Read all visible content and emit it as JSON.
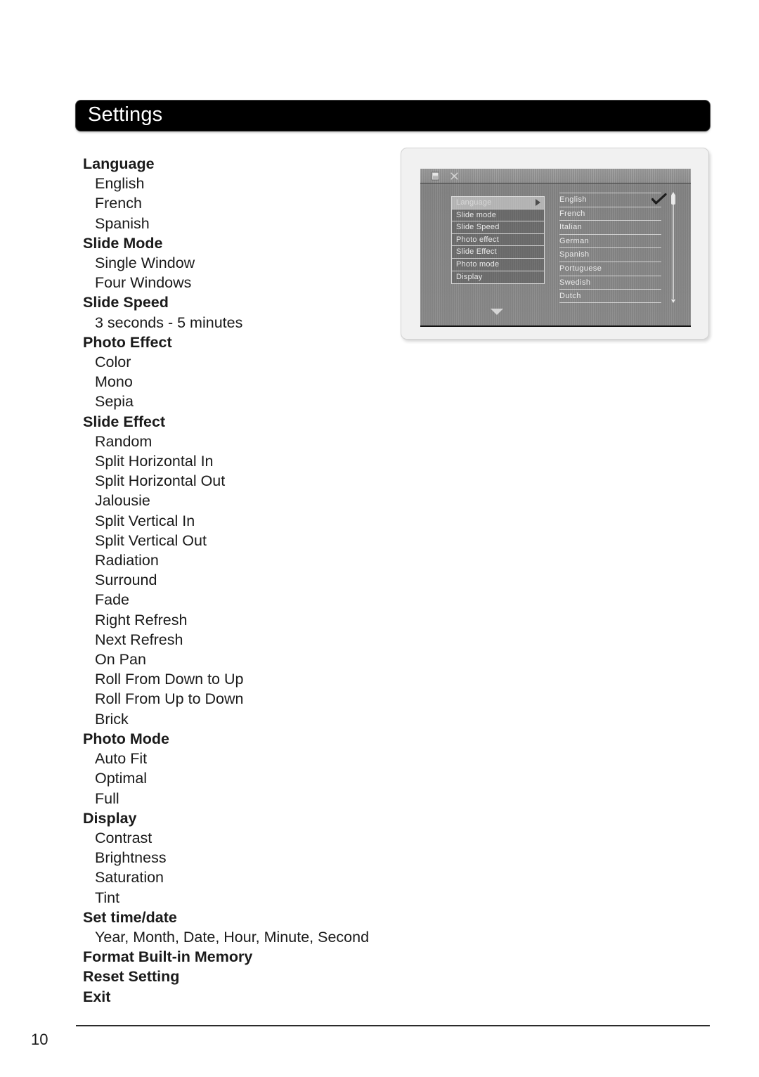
{
  "page": {
    "title": "Settings",
    "number": "10"
  },
  "settings_outline": [
    {
      "title": "Language",
      "items": [
        "English",
        "French",
        "Spanish"
      ]
    },
    {
      "title": "Slide Mode",
      "items": [
        "Single Window",
        "Four Windows"
      ]
    },
    {
      "title": "Slide Speed",
      "items": [
        "3 seconds - 5 minutes"
      ]
    },
    {
      "title": "Photo Effect",
      "items": [
        "Color",
        "Mono",
        "Sepia"
      ]
    },
    {
      "title": "Slide Effect",
      "items": [
        "Random",
        "Split Horizontal In",
        "Split Horizontal Out",
        "Jalousie",
        "Split Vertical In",
        "Split Vertical Out",
        "Radiation",
        "Surround",
        "Fade",
        "Right Refresh",
        "Next Refresh",
        "On Pan",
        "Roll From Down to Up",
        "Roll From Up to Down",
        "Brick"
      ]
    },
    {
      "title": "Photo Mode",
      "items": [
        "Auto Fit",
        "Optimal",
        "Full"
      ]
    },
    {
      "title": "Display",
      "items": [
        "Contrast",
        "Brightness",
        "Saturation",
        "Tint"
      ]
    },
    {
      "title": "Set time/date",
      "items": [
        "Year, Month, Date, Hour, Minute, Second"
      ]
    },
    {
      "title": "Format Built-in Memory",
      "items": []
    },
    {
      "title": "Reset Setting",
      "items": []
    },
    {
      "title": "Exit",
      "items": []
    }
  ],
  "device": {
    "toolbar_icons": [
      "memory-card-icon",
      "tools-icon"
    ],
    "menu": [
      {
        "label": "Language",
        "selected": true,
        "has_submenu": true
      },
      {
        "label": "Slide mode",
        "selected": false,
        "has_submenu": false
      },
      {
        "label": "Slide Speed",
        "selected": false,
        "has_submenu": false
      },
      {
        "label": "Photo effect",
        "selected": false,
        "has_submenu": false
      },
      {
        "label": "Slide Effect",
        "selected": false,
        "has_submenu": false
      },
      {
        "label": "Photo mode",
        "selected": false,
        "has_submenu": false
      },
      {
        "label": "Display",
        "selected": false,
        "has_submenu": false
      }
    ],
    "scroll_down_indicator": "chevron-down-icon",
    "options": [
      {
        "label": "English",
        "checked": true
      },
      {
        "label": "French",
        "checked": false
      },
      {
        "label": "Italian",
        "checked": false
      },
      {
        "label": "German",
        "checked": false
      },
      {
        "label": "Spanish",
        "checked": false
      },
      {
        "label": "Portuguese",
        "checked": false
      },
      {
        "label": "Swedish",
        "checked": false
      },
      {
        "label": "Dutch",
        "checked": false
      }
    ]
  },
  "colors": {
    "header_bar": "#000000",
    "header_text": "#ffffff",
    "body_text": "#1a1a1a",
    "device_frame": "#f1f1f1",
    "device_screen": "#8a8a8a"
  }
}
